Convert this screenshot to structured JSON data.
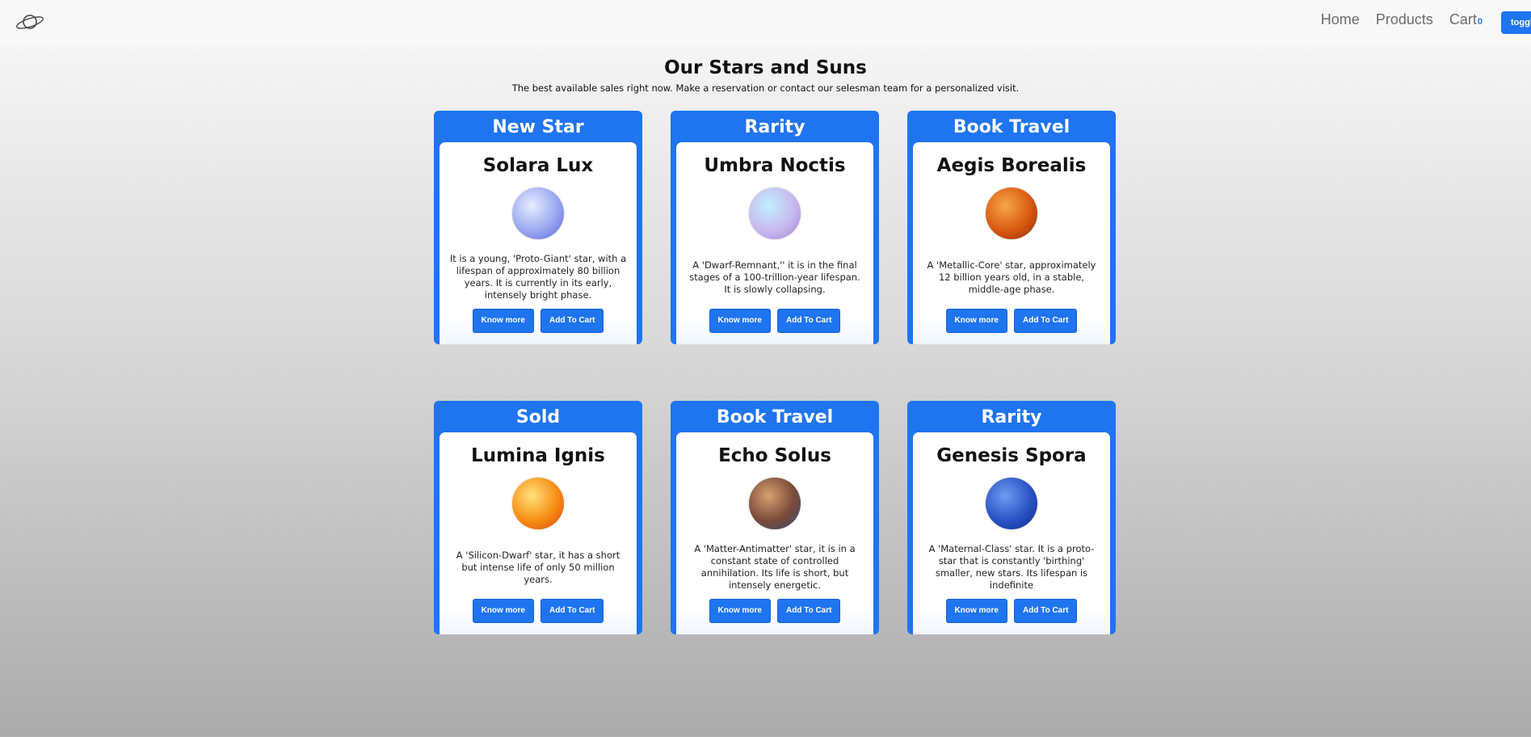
{
  "nav": {
    "links": [
      "Home",
      "Products",
      "Cart"
    ],
    "cart_count": "0",
    "toggle_label": "toggle"
  },
  "header": {
    "title": "Our Stars and Suns",
    "subtitle": "The best available sales right now. Make a reservation or contact our selesman team for a personalized visit."
  },
  "cards": [
    {
      "badge": "New Star",
      "name": "Solara Lux",
      "desc": "It is a young, 'Proto-Giant' star, with a lifespan of approximately 80 billion years. It is currently in its early, intensely bright phase.",
      "know_more": "Know more",
      "add_to_cart": "Add To Cart",
      "colors": [
        "#e8ecff",
        "#9aa8f0",
        "#5a63d8"
      ]
    },
    {
      "badge": "Rarity",
      "name": "Umbra Noctis",
      "desc": "A 'Dwarf-Remnant,'' it is in the final stages of a 100-trillion-year lifespan. It is slowly collapsing.",
      "know_more": "Know more",
      "add_to_cart": "Add To Cart",
      "colors": [
        "#bff0ff",
        "#c9b8ee",
        "#9b86d6"
      ]
    },
    {
      "badge": "Book Travel",
      "name": "Aegis Borealis",
      "desc": "A 'Metallic-Core' star, approximately 12 billion years old, in a stable, middle-age phase.",
      "know_more": "Know more",
      "add_to_cart": "Add To Cart",
      "colors": [
        "#f7a64a",
        "#d85a10",
        "#8a2a06"
      ]
    },
    {
      "badge": "Sold",
      "name": "Lumina Ignis",
      "desc": "A 'Silicon-Dwarf' star, it has a short but intense life of only 50 million years.",
      "know_more": "Know more",
      "add_to_cart": "Add To Cart",
      "colors": [
        "#ffe27a",
        "#f78d14",
        "#d9440a"
      ]
    },
    {
      "badge": "Book Travel",
      "name": "Echo Solus",
      "desc": "A 'Matter-Antimatter' star, it is in a constant state of controlled annihilation. Its life is short, but intensely energetic.",
      "know_more": "Know more",
      "add_to_cart": "Add To Cart",
      "colors": [
        "#d9a070",
        "#7a4a3a",
        "#2c4e7a"
      ]
    },
    {
      "badge": "Rarity",
      "name": "Genesis Spora",
      "desc": "A 'Maternal-Class' star. It is a proto-star that is constantly 'birthing' smaller, new stars. Its lifespan is indefinite",
      "know_more": "Know more",
      "add_to_cart": "Add To Cart",
      "colors": [
        "#6f9cf2",
        "#2a52c4",
        "#0e2a8a"
      ]
    }
  ]
}
